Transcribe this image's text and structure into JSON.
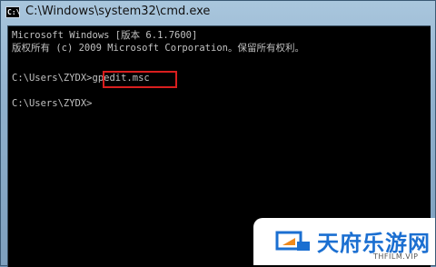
{
  "window": {
    "title": "C:\\Windows\\system32\\cmd.exe",
    "icon_text": "C:\\"
  },
  "console": {
    "lines": [
      "Microsoft Windows [版本 6.1.7600]",
      "版权所有 (c) 2009 Microsoft Corporation。保留所有权利。",
      "",
      "C:\\Users\\ZYDX>gpedit.msc",
      "",
      "C:\\Users\\ZYDX>"
    ],
    "highlighted_command": "gpedit.msc",
    "highlight_color": "#d81e1e",
    "text_color": "#c0c0c0",
    "background_color": "#000000"
  },
  "watermark": {
    "name": "天府乐游网",
    "url": "THFILM.VIP",
    "brand_color": "#1b6fd1",
    "accent_color": "#f08a1c"
  }
}
